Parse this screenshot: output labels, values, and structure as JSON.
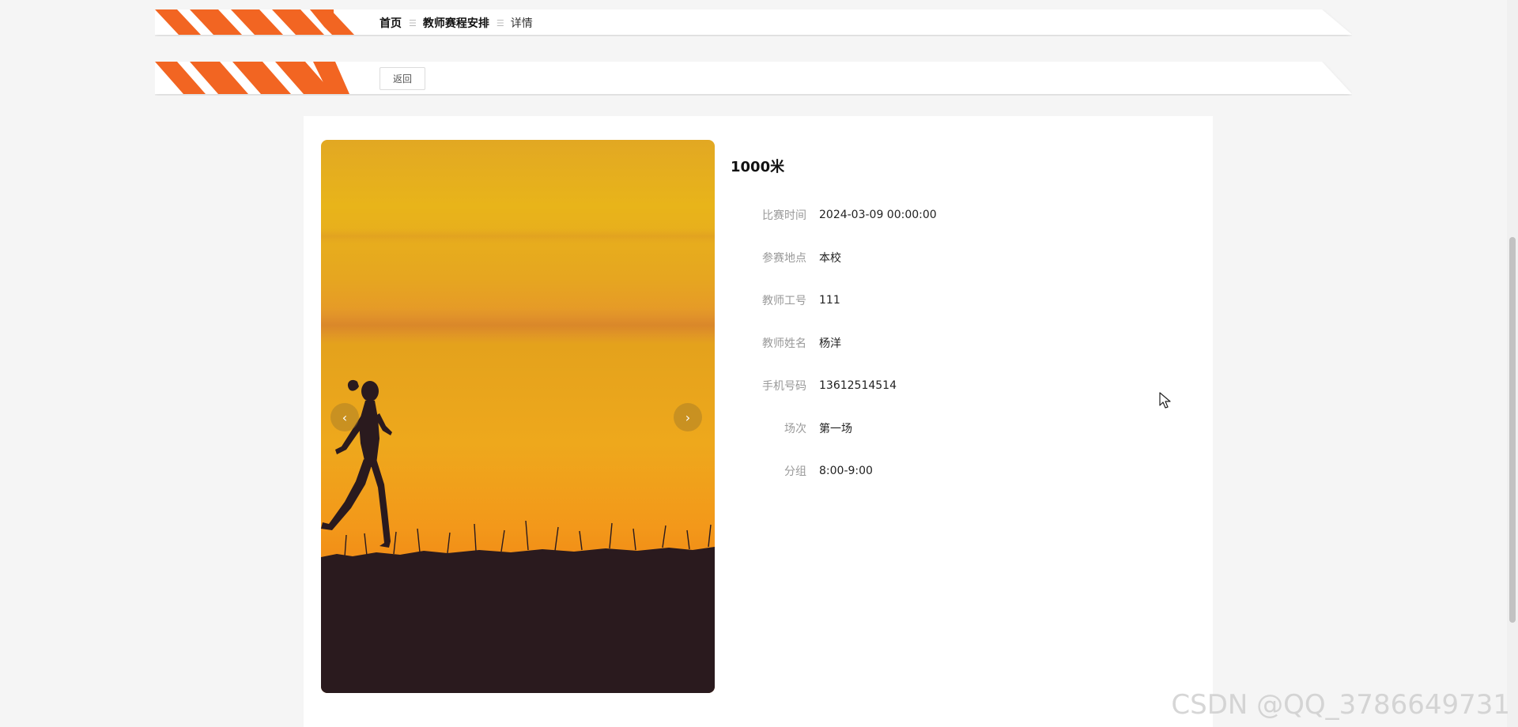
{
  "breadcrumb": {
    "home": "首页",
    "section": "教师赛程安排",
    "current": "详情"
  },
  "actions": {
    "back_label": "返回"
  },
  "detail": {
    "title": "1000米",
    "fields": [
      {
        "label": "比赛时间",
        "value": "2024-03-09 00:00:00"
      },
      {
        "label": "参赛地点",
        "value": "本校"
      },
      {
        "label": "教师工号",
        "value": "111"
      },
      {
        "label": "教师姓名",
        "value": "杨洋"
      },
      {
        "label": "手机号码",
        "value": "13612514514"
      },
      {
        "label": "场次",
        "value": "第一场"
      },
      {
        "label": "分组",
        "value": "8:00-9:00"
      }
    ]
  },
  "carousel": {
    "prev_glyph": "‹",
    "next_glyph": "›"
  },
  "breadcrumb_separator": "☰",
  "watermark": "CSDN @QQ_3786649731",
  "colors": {
    "accent": "#f26522",
    "sky_top": "#e8b020",
    "sky_mid": "#eeb018",
    "horizon": "#f58a1a",
    "ground": "#2a1a1e"
  }
}
